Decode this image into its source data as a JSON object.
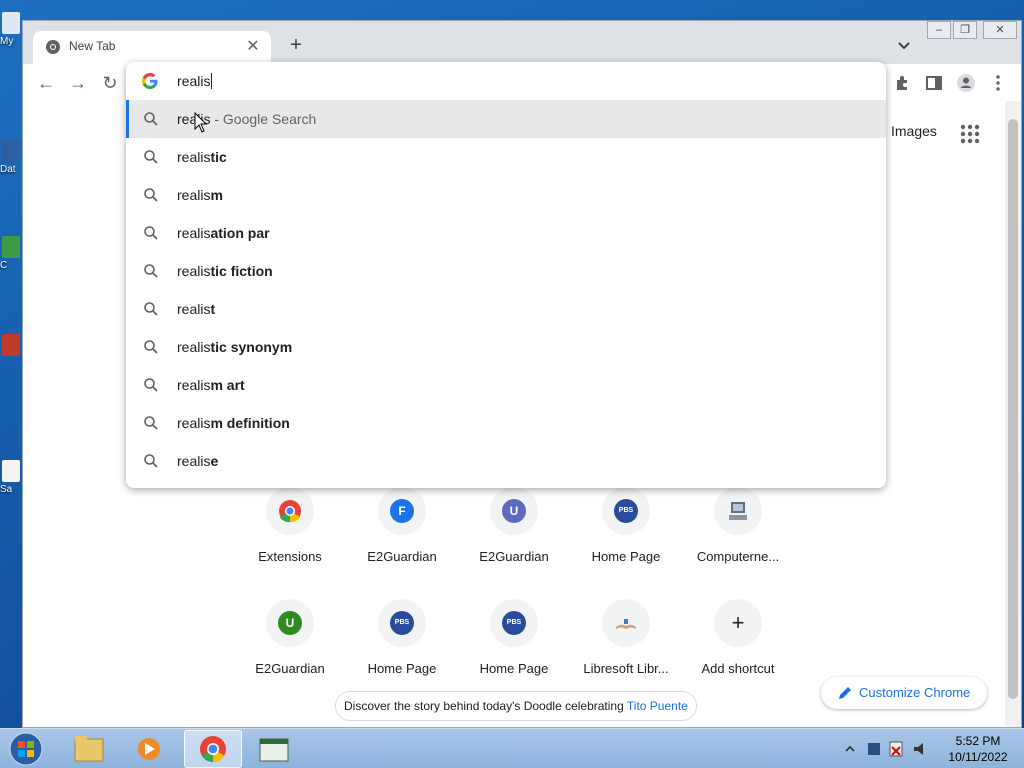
{
  "desktop": {
    "icons": [
      {
        "label": "My",
        "color": "#4a76b0"
      },
      {
        "label": "Dat",
        "color": "#2f5e9e"
      },
      {
        "label": "C",
        "color": "#3d9b47"
      },
      {
        "label": "",
        "color": "#c0392b"
      },
      {
        "label": "Sa",
        "color": "#ffffff"
      }
    ]
  },
  "browser": {
    "tab": {
      "title": "New Tab",
      "close_icon": "close-icon"
    },
    "new_tab_label": "+",
    "window_buttons": {
      "minimize": "–",
      "restore": "❐",
      "close": "✕"
    },
    "omnibox": {
      "query": "realis",
      "suggestions": [
        {
          "typed": "realis",
          "completion": "",
          "suffix": " - Google Search",
          "selected": true
        },
        {
          "typed": "realis",
          "completion": "tic",
          "suffix": "",
          "selected": false
        },
        {
          "typed": "realis",
          "completion": "m",
          "suffix": "",
          "selected": false
        },
        {
          "typed": "realis",
          "completion": "ation par",
          "suffix": "",
          "selected": false
        },
        {
          "typed": "realis",
          "completion": "tic fiction",
          "suffix": "",
          "selected": false
        },
        {
          "typed": "realis",
          "completion": "t",
          "suffix": "",
          "selected": false
        },
        {
          "typed": "realis",
          "completion": "tic synonym",
          "suffix": "",
          "selected": false
        },
        {
          "typed": "realis",
          "completion": "m art",
          "suffix": "",
          "selected": false
        },
        {
          "typed": "realis",
          "completion": "m definition",
          "suffix": "",
          "selected": false
        },
        {
          "typed": "realis",
          "completion": "e",
          "suffix": "",
          "selected": false
        }
      ]
    }
  },
  "ntp": {
    "images_link": "Images",
    "shortcuts": [
      {
        "label": "Extensions",
        "icon": "chrome-icon",
        "letter": "",
        "color": "#ea4335"
      },
      {
        "label": "E2Guardian",
        "icon": "letter-f-icon",
        "letter": "F",
        "color": "#1a73e8"
      },
      {
        "label": "E2Guardian",
        "icon": "letter-u-icon",
        "letter": "U",
        "color": "#5c6bc0"
      },
      {
        "label": "Home Page",
        "icon": "pbs-kids-icon",
        "letter": "PBS",
        "color": "#2b4c9b"
      },
      {
        "label": "Computerne...",
        "icon": "computer-icon",
        "letter": "",
        "color": "#607080"
      },
      {
        "label": "E2Guardian",
        "icon": "letter-u-icon",
        "letter": "U",
        "color": "#2e8b20"
      },
      {
        "label": "Home Page",
        "icon": "pbs-kids-icon",
        "letter": "PBS",
        "color": "#2b4c9b"
      },
      {
        "label": "Home Page",
        "icon": "pbs-kids-icon",
        "letter": "PBS",
        "color": "#2b4c9b"
      },
      {
        "label": "Libresoft Libr...",
        "icon": "book-icon",
        "letter": "",
        "color": "#d4a070"
      },
      {
        "label": "Add shortcut",
        "icon": "plus-icon",
        "letter": "+",
        "color": "#202124"
      }
    ],
    "doodle_text": "Discover the story behind today's Doodle celebrating ",
    "doodle_link": "Tito Puente",
    "customize_label": "Customize Chrome"
  },
  "taskbar": {
    "time": "5:52 PM",
    "date": "10/11/2022"
  }
}
